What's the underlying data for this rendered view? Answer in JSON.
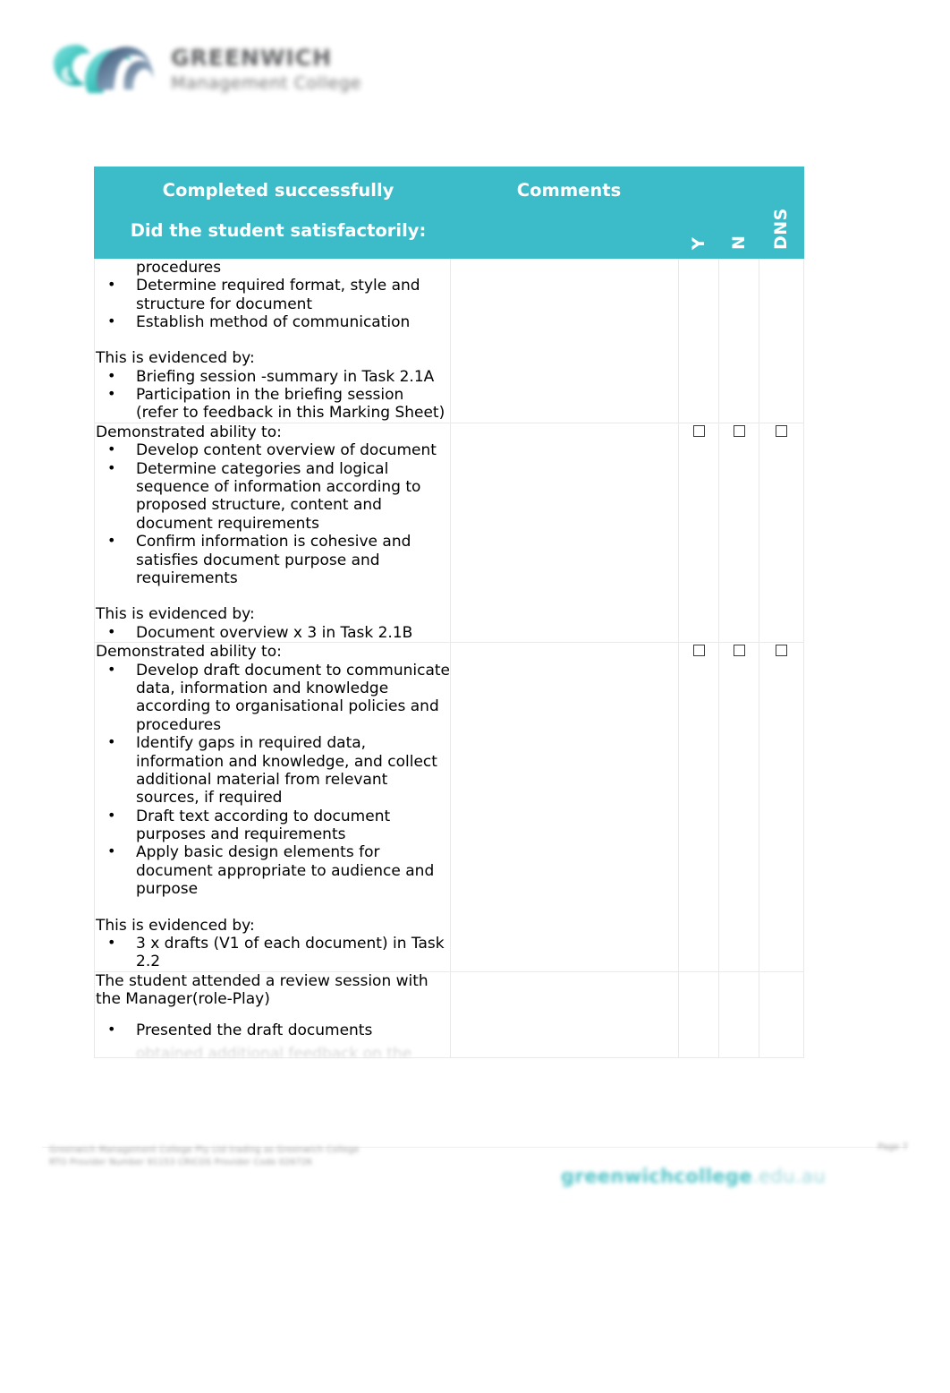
{
  "document": {
    "logo": {
      "mark_icon": "greenwich-gm-monogram-icon",
      "title": "GREENWICH",
      "subtitle": "Management College"
    }
  },
  "table": {
    "header": {
      "criteria_line1": "Completed successfully",
      "criteria_line2": "Did the student satisfactorily:",
      "comments": "Comments",
      "col_y": "Y",
      "col_n": "N",
      "col_dns": "DNS"
    },
    "rows": [
      {
        "id": "row-1",
        "continued_line": "procedures",
        "bullets_top": [
          "Determine required format, style and structure for document",
          "Establish method of communication"
        ],
        "evidence_lead": "This is evidenced by:",
        "evidence_bullets": [
          "Briefing session -summary in Task 2.1A",
          "Participation in the briefing session (refer to feedback in this Marking Sheet)"
        ],
        "comments": "",
        "checkbox_y": false,
        "checkbox_n": false,
        "checkbox_dns": false,
        "show_checkboxes": false
      },
      {
        "id": "row-2",
        "lead": "Demonstrated ability to:",
        "bullets_top": [
          "Develop content overview of document",
          "Determine categories and logical sequence of information according to proposed structure, content and document requirements",
          "Confirm information is cohesive and satisfies document purpose and requirements"
        ],
        "evidence_lead": "This is evidenced by:",
        "evidence_bullets": [
          "Document overview x 3 in Task 2.1B"
        ],
        "comments": "",
        "checkbox_y": false,
        "checkbox_n": false,
        "checkbox_dns": false,
        "show_checkboxes": true
      },
      {
        "id": "row-3",
        "lead": "Demonstrated ability to:",
        "bullets_top": [
          "Develop draft document to communicate data, information and knowledge according to organisational policies and procedures",
          "Identify gaps in required data, information and knowledge, and collect additional material from relevant sources, if required",
          "Draft text according to document purposes and requirements",
          "Apply basic design elements for document appropriate to audience and purpose"
        ],
        "evidence_lead": "This is evidenced by:",
        "evidence_bullets": [
          "3 x drafts (V1 of each document) in Task 2.2"
        ],
        "comments": "",
        "checkbox_y": false,
        "checkbox_n": false,
        "checkbox_dns": false,
        "show_checkboxes": true
      },
      {
        "id": "row-4",
        "lead": "The student attended a review session with the Manager(role-Play)",
        "bullets_top": [
          "Presented the draft documents"
        ],
        "clipped_text": "obtained additional feedback on the",
        "comments": "",
        "checkbox_y": false,
        "checkbox_n": false,
        "checkbox_dns": false,
        "show_checkboxes": false
      }
    ]
  },
  "footer": {
    "left_line1": "Greenwich Management College Pty Ltd trading as Greenwich College",
    "left_line2": "RTO Provider Number 91153   CRICOS Provider Code 02672K",
    "page_label": "Page 7",
    "url_name": "greenwichcollege",
    "url_domain": ".edu.au"
  },
  "colors": {
    "header_teal": "#3bbcc8",
    "footer_url_teal": "#52c4c8",
    "border_gray": "#e9e9e9",
    "text_black": "#000000"
  }
}
